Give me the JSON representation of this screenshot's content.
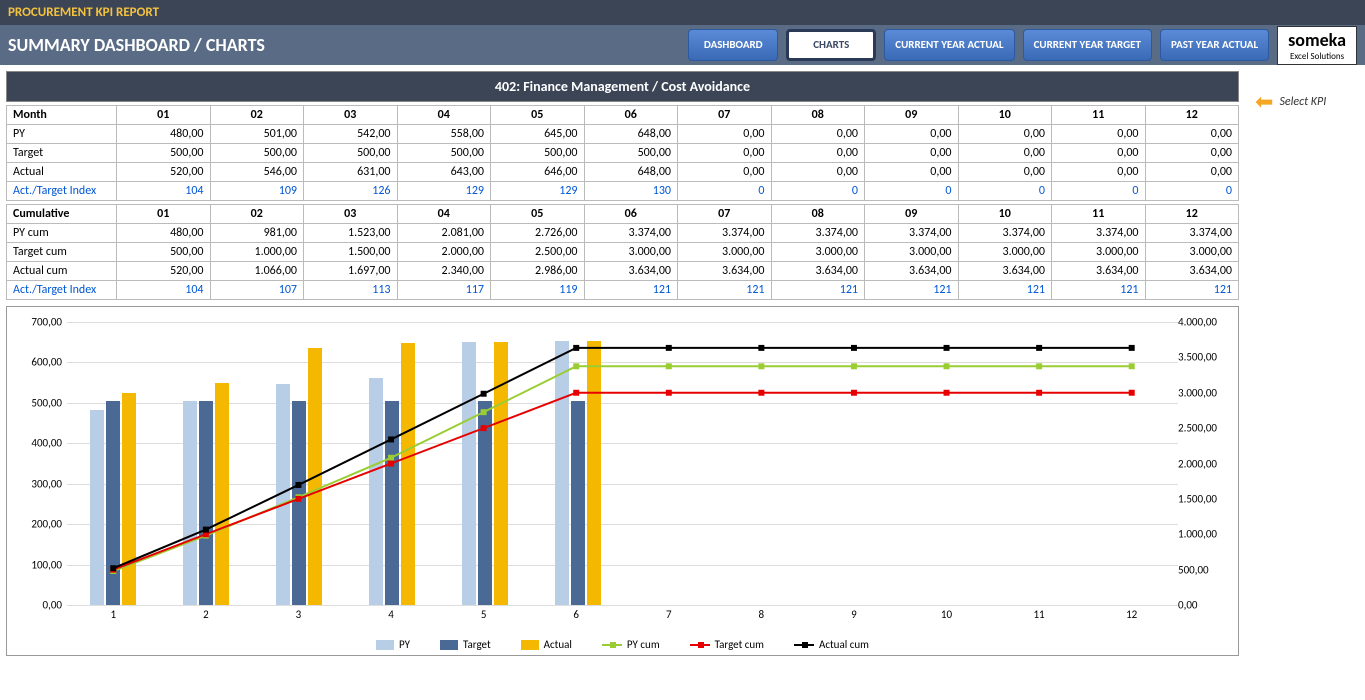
{
  "header": {
    "report_title": "PROCUREMENT KPI REPORT",
    "subtitle": "SUMMARY DASHBOARD / CHARTS"
  },
  "nav": {
    "dashboard": "DASHBOARD",
    "charts": "CHARTS",
    "cy_actual": "CURRENT YEAR ACTUAL",
    "cy_target": "CURRENT YEAR TARGET",
    "py_actual": "PAST YEAR ACTUAL"
  },
  "logo": {
    "name": "someka",
    "sub": "Excel Solutions"
  },
  "kpi": {
    "banner": "402: Finance Management / Cost Avoidance",
    "select_label": "Select KPI"
  },
  "table1": {
    "header_label": "Month",
    "months": [
      "01",
      "02",
      "03",
      "04",
      "05",
      "06",
      "07",
      "08",
      "09",
      "10",
      "11",
      "12"
    ],
    "rows": [
      {
        "label": "PY",
        "vals": [
          "480,00",
          "501,00",
          "542,00",
          "558,00",
          "645,00",
          "648,00",
          "0,00",
          "0,00",
          "0,00",
          "0,00",
          "0,00",
          "0,00"
        ]
      },
      {
        "label": "Target",
        "vals": [
          "500,00",
          "500,00",
          "500,00",
          "500,00",
          "500,00",
          "500,00",
          "0,00",
          "0,00",
          "0,00",
          "0,00",
          "0,00",
          "0,00"
        ]
      },
      {
        "label": "Actual",
        "vals": [
          "520,00",
          "546,00",
          "631,00",
          "643,00",
          "646,00",
          "648,00",
          "0,00",
          "0,00",
          "0,00",
          "0,00",
          "0,00",
          "0,00"
        ]
      },
      {
        "label": "Act./Target Index",
        "idx": true,
        "vals": [
          "104",
          "109",
          "126",
          "129",
          "129",
          "130",
          "0",
          "0",
          "0",
          "0",
          "0",
          "0"
        ]
      }
    ]
  },
  "table2": {
    "header_label": "Cumulative",
    "months": [
      "01",
      "02",
      "03",
      "04",
      "05",
      "06",
      "07",
      "08",
      "09",
      "10",
      "11",
      "12"
    ],
    "rows": [
      {
        "label": "PY cum",
        "vals": [
          "480,00",
          "981,00",
          "1.523,00",
          "2.081,00",
          "2.726,00",
          "3.374,00",
          "3.374,00",
          "3.374,00",
          "3.374,00",
          "3.374,00",
          "3.374,00",
          "3.374,00"
        ]
      },
      {
        "label": "Target cum",
        "vals": [
          "500,00",
          "1.000,00",
          "1.500,00",
          "2.000,00",
          "2.500,00",
          "3.000,00",
          "3.000,00",
          "3.000,00",
          "3.000,00",
          "3.000,00",
          "3.000,00",
          "3.000,00"
        ]
      },
      {
        "label": "Actual cum",
        "vals": [
          "520,00",
          "1.066,00",
          "1.697,00",
          "2.340,00",
          "2.986,00",
          "3.634,00",
          "3.634,00",
          "3.634,00",
          "3.634,00",
          "3.634,00",
          "3.634,00",
          "3.634,00"
        ]
      },
      {
        "label": "Act./Target Index",
        "idx": true,
        "vals": [
          "104",
          "107",
          "113",
          "117",
          "119",
          "121",
          "121",
          "121",
          "121",
          "121",
          "121",
          "121"
        ]
      }
    ]
  },
  "chart_data": {
    "type": "bar+line",
    "categories": [
      "1",
      "2",
      "3",
      "4",
      "5",
      "6",
      "7",
      "8",
      "9",
      "10",
      "11",
      "12"
    ],
    "y_left": {
      "min": 0,
      "max": 700,
      "step": 100,
      "ticks": [
        "0,00",
        "100,00",
        "200,00",
        "300,00",
        "400,00",
        "500,00",
        "600,00",
        "700,00"
      ]
    },
    "y_right": {
      "min": 0,
      "max": 4000,
      "step": 500,
      "ticks": [
        "0,00",
        "500,00",
        "1.000,00",
        "1.500,00",
        "2.000,00",
        "2.500,00",
        "3.000,00",
        "3.500,00",
        "4.000,00"
      ]
    },
    "bar_series": [
      {
        "name": "PY",
        "color": "#b8cde6",
        "values": [
          480,
          501,
          542,
          558,
          645,
          648,
          0,
          0,
          0,
          0,
          0,
          0
        ]
      },
      {
        "name": "Target",
        "color": "#4a6a95",
        "values": [
          500,
          500,
          500,
          500,
          500,
          500,
          0,
          0,
          0,
          0,
          0,
          0
        ]
      },
      {
        "name": "Actual",
        "color": "#f5b800",
        "values": [
          520,
          546,
          631,
          643,
          646,
          648,
          0,
          0,
          0,
          0,
          0,
          0
        ]
      }
    ],
    "line_series": [
      {
        "name": "PY cum",
        "color": "#9acd32",
        "values": [
          480,
          981,
          1523,
          2081,
          2726,
          3374,
          3374,
          3374,
          3374,
          3374,
          3374,
          3374
        ]
      },
      {
        "name": "Target cum",
        "color": "#e60000",
        "values": [
          500,
          1000,
          1500,
          2000,
          2500,
          3000,
          3000,
          3000,
          3000,
          3000,
          3000,
          3000
        ]
      },
      {
        "name": "Actual cum",
        "color": "#000000",
        "values": [
          520,
          1066,
          1697,
          2340,
          2986,
          3634,
          3634,
          3634,
          3634,
          3634,
          3634,
          3634
        ]
      }
    ],
    "legend": [
      "PY",
      "Target",
      "Actual",
      "PY cum",
      "Target cum",
      "Actual cum"
    ]
  }
}
